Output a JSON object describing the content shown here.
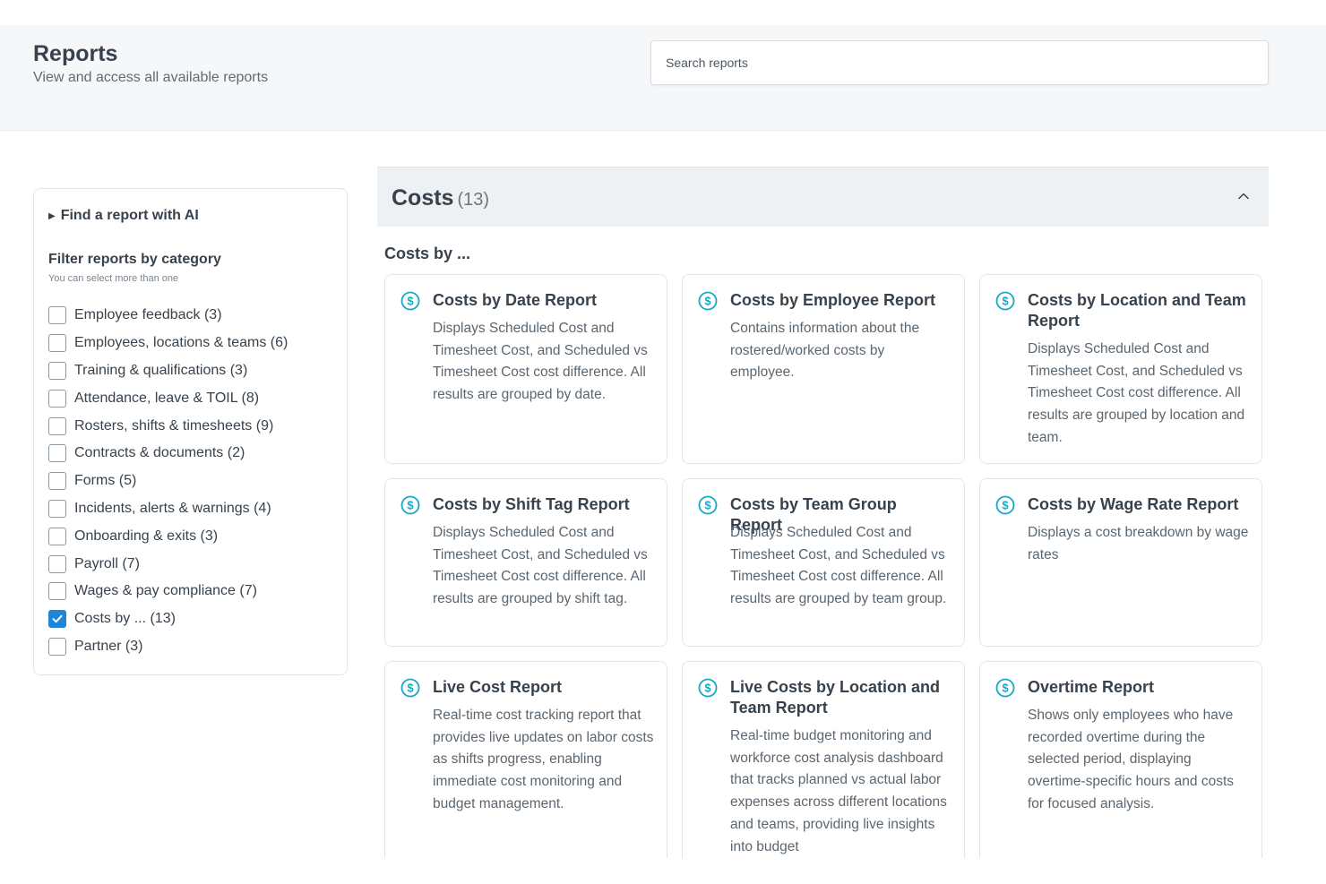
{
  "header": {
    "title": "Reports",
    "subtitle": "View and access all available reports",
    "search_placeholder": "Search reports"
  },
  "sidebar": {
    "ai_toggle": "Find a report with AI",
    "filter_title": "Filter reports by category",
    "filter_hint": "You can select more than one",
    "categories": [
      {
        "label": "Employee feedback (3)",
        "checked": false
      },
      {
        "label": "Employees, locations & teams (6)",
        "checked": false
      },
      {
        "label": "Training & qualifications (3)",
        "checked": false
      },
      {
        "label": "Attendance, leave & TOIL (8)",
        "checked": false
      },
      {
        "label": "Rosters, shifts & timesheets (9)",
        "checked": false
      },
      {
        "label": "Contracts & documents (2)",
        "checked": false
      },
      {
        "label": "Forms (5)",
        "checked": false
      },
      {
        "label": "Incidents, alerts & warnings (4)",
        "checked": false
      },
      {
        "label": "Onboarding & exits (3)",
        "checked": false
      },
      {
        "label": "Payroll (7)",
        "checked": false
      },
      {
        "label": "Wages & pay compliance (7)",
        "checked": false
      },
      {
        "label": "Costs by ... (13)",
        "checked": true
      },
      {
        "label": "Partner (3)",
        "checked": false
      }
    ]
  },
  "section": {
    "title": "Costs",
    "count": "(13)",
    "subsection": "Costs by ..."
  },
  "cards": [
    {
      "title": "Costs by Date Report",
      "desc": "Displays Scheduled Cost and Timesheet Cost, and Scheduled vs Timesheet Cost cost difference. All results are grouped by date."
    },
    {
      "title": "Costs by Employee Report",
      "desc": "Contains information about the rostered/worked costs by employee."
    },
    {
      "title": "Costs by Location and Team Report",
      "desc": "Displays Scheduled Cost and Timesheet Cost, and Scheduled vs Timesheet Cost cost difference. All results are grouped by location and team."
    },
    {
      "title": "Costs by Shift Tag Report",
      "desc": "Displays Scheduled Cost and Timesheet Cost, and Scheduled vs Timesheet Cost cost difference. All results are grouped by shift tag."
    },
    {
      "title": "Costs by Team Group Report",
      "desc": "Displays Scheduled Cost and Timesheet Cost, and Scheduled vs Timesheet Cost cost difference. All results are grouped by team group."
    },
    {
      "title": "Costs by Wage Rate Report",
      "desc": "Displays a cost breakdown by wage rates"
    },
    {
      "title": "Live Cost Report",
      "desc": "Real-time cost tracking report that provides live updates on labor costs as shifts progress, enabling immediate cost monitoring and budget management."
    },
    {
      "title": "Live Costs by Location and Team Report",
      "desc": "Real-time budget monitoring and workforce cost analysis dashboard that tracks planned vs actual labor expenses across different locations and teams, providing live insights into budget"
    },
    {
      "title": "Overtime Report",
      "desc": "Shows only employees who have recorded overtime during the selected period, displaying overtime-specific hours and costs for focused analysis."
    }
  ],
  "colors": {
    "accent": "#1c86d9",
    "icon_teal": "#16a9c7"
  }
}
